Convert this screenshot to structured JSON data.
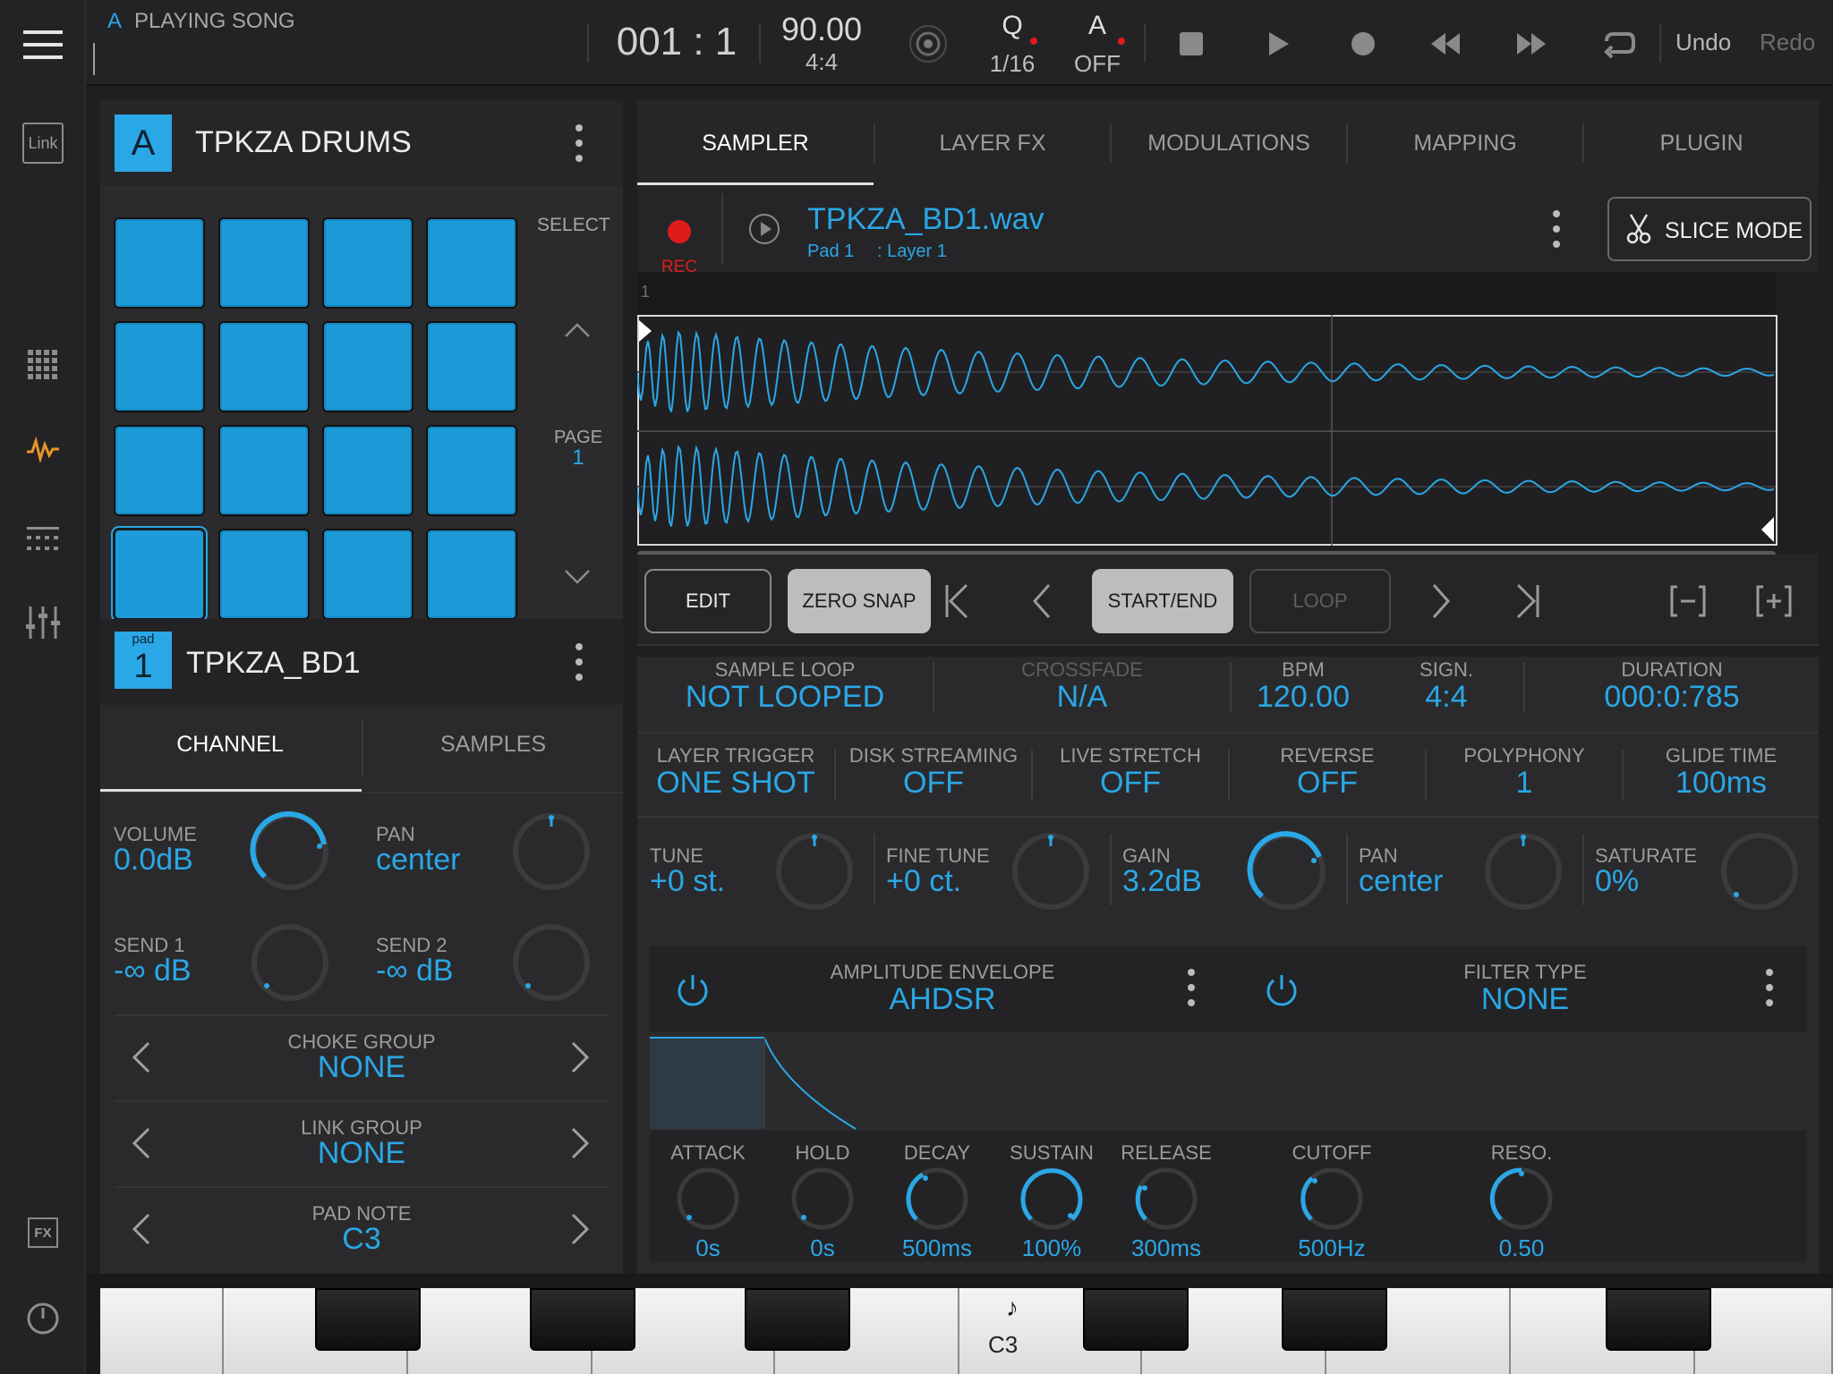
{
  "topbar": {
    "track_letter": "A",
    "song_status": "PLAYING SONG",
    "position": "001 : 1",
    "tempo": "90.00",
    "signature": "4:4",
    "quantize_label": "Q",
    "quantize_value": "1/16",
    "auto_label": "A",
    "auto_value": "OFF",
    "undo": "Undo",
    "redo": "Redo"
  },
  "rail": {
    "link_label": "Link",
    "fx_label": "FX"
  },
  "instrument": {
    "letter": "A",
    "name": "TPKZA DRUMS",
    "select_label": "SELECT",
    "page_label": "PAGE",
    "page_value": "1"
  },
  "pad": {
    "pad_small": "pad",
    "pad_number": "1",
    "name": "TPKZA_BD1"
  },
  "left_tabs": {
    "channel": "CHANNEL",
    "samples": "SAMPLES"
  },
  "channel": {
    "volume_label": "VOLUME",
    "volume_value": "0.0dB",
    "pan_label": "PAN",
    "pan_value": "center",
    "send1_label": "SEND 1",
    "send1_value": "-∞ dB",
    "send2_label": "SEND 2",
    "send2_value": "-∞ dB",
    "choke_label": "CHOKE GROUP",
    "choke_value": "NONE",
    "link_label": "LINK GROUP",
    "link_value": "NONE",
    "note_label": "PAD NOTE",
    "note_value": "C3"
  },
  "right_tabs": [
    "SAMPLER",
    "LAYER FX",
    "MODULATIONS",
    "MAPPING",
    "PLUGIN"
  ],
  "sample": {
    "rec_label": "REC",
    "file": "TPKZA_BD1.wav",
    "pad_info": "Pad 1",
    "layer_info": ": Layer 1",
    "slice_mode": "SLICE MODE",
    "marker": "1"
  },
  "edit_bar": {
    "edit": "EDIT",
    "zero_snap": "ZERO SNAP",
    "start_end": "START/END",
    "loop": "LOOP"
  },
  "params_row1": {
    "sample_loop_label": "SAMPLE LOOP",
    "sample_loop_value": "NOT LOOPED",
    "crossfade_label": "CROSSFADE",
    "crossfade_value": "N/A",
    "bpm_label": "BPM",
    "bpm_value": "120.00",
    "sign_label": "SIGN.",
    "sign_value": "4:4",
    "duration_label": "DURATION",
    "duration_value": "000:0:785"
  },
  "params_row2": {
    "trigger_label": "LAYER TRIGGER",
    "trigger_value": "ONE SHOT",
    "disk_label": "DISK STREAMING",
    "disk_value": "OFF",
    "stretch_label": "LIVE STRETCH",
    "stretch_value": "OFF",
    "reverse_label": "REVERSE",
    "reverse_value": "OFF",
    "poly_label": "POLYPHONY",
    "poly_value": "1",
    "glide_label": "GLIDE TIME",
    "glide_value": "100ms"
  },
  "params_row3": {
    "tune_label": "TUNE",
    "tune_value": "+0 st.",
    "fine_label": "FINE TUNE",
    "fine_value": "+0 ct.",
    "gain_label": "GAIN",
    "gain_value": "3.2dB",
    "pan_label": "PAN",
    "pan_value": "center",
    "sat_label": "SATURATE",
    "sat_value": "0%"
  },
  "amp_env": {
    "title": "AMPLITUDE ENVELOPE",
    "type": "AHDSR",
    "attack_label": "ATTACK",
    "attack_value": "0s",
    "hold_label": "HOLD",
    "hold_value": "0s",
    "decay_label": "DECAY",
    "decay_value": "500ms",
    "sustain_label": "SUSTAIN",
    "sustain_value": "100%",
    "release_label": "RELEASE",
    "release_value": "300ms"
  },
  "filter": {
    "title": "FILTER TYPE",
    "type": "NONE",
    "cutoff_label": "CUTOFF",
    "cutoff_value": "500Hz",
    "reso_label": "RESO.",
    "reso_value": "0.50"
  },
  "keyboard": {
    "c3_label": "C3",
    "note_glyph": "♪"
  },
  "colors": {
    "accent": "#2aa7e6",
    "record": "#e01b1b",
    "envelope_accent": "#2aa7e6"
  }
}
